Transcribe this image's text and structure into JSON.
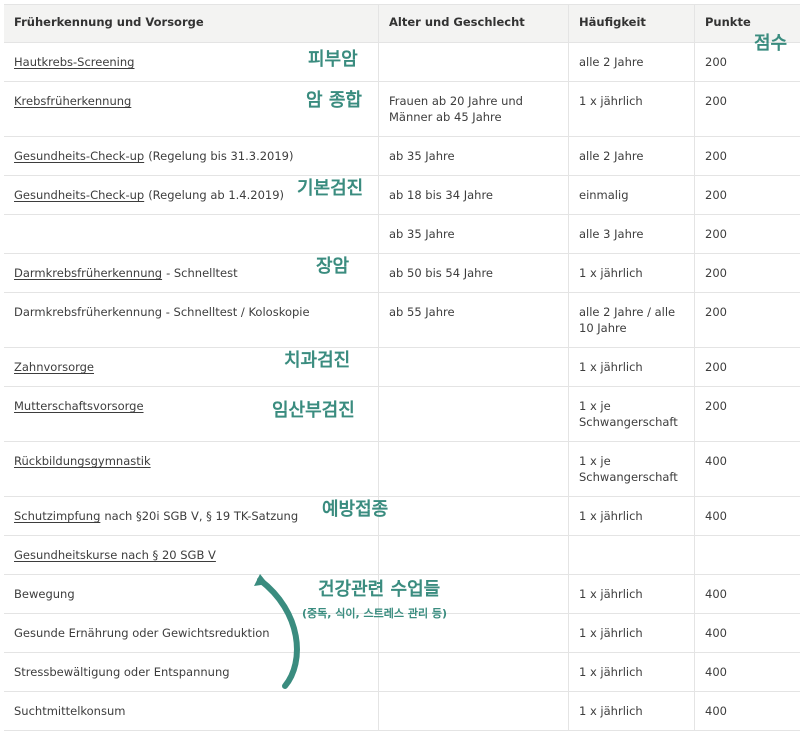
{
  "headers": {
    "col1": "Früherkennung und Vorsorge",
    "col2": "Alter und Geschlecht",
    "col3": "Häufigkeit",
    "col4": "Punkte"
  },
  "points_note": "점수",
  "rows": [
    {
      "c1": "Hautkrebs-Screening",
      "c1_extra": "",
      "c1_link": true,
      "c2": "",
      "c3": "alle 2 Jahre",
      "c4": "200",
      "note": "피부암",
      "h": "r1"
    },
    {
      "c1": "Krebsfrüherkennung",
      "c1_extra": "",
      "c1_link": true,
      "c2": "Frauen ab 20 Jahre und Männer ab 45 Jahre",
      "c3": "1 x jährlich",
      "c4": "200",
      "note": "암 종합",
      "h": "r2"
    },
    {
      "c1": "Gesundheits-Check-up",
      "c1_extra": "(Regelung bis 31.3.2019)",
      "c1_link": true,
      "c2": "ab 35 Jahre",
      "c3": "alle 2 Jahre",
      "c4": "200",
      "note": "",
      "h": "r1"
    },
    {
      "c1": "Gesundheits-Check-up",
      "c1_extra": "(Regelung ab 1.4.2019)",
      "c1_link": true,
      "c2": "ab 18 bis 34 Jahre",
      "c3": "einmalig",
      "c4": "200",
      "note": "기본검진",
      "h": "r1"
    },
    {
      "c1": "",
      "c1_extra": "",
      "c1_link": false,
      "c2": "ab 35 Jahre",
      "c3": "alle 3 Jahre",
      "c4": "200",
      "note": "",
      "h": "r1"
    },
    {
      "c1": "Darmkrebsfrüherkennung",
      "c1_extra": "- Schnelltest",
      "c1_link": true,
      "c2": "ab 50 bis 54 Jahre",
      "c3": "1 x jährlich",
      "c4": "200",
      "note": "장암",
      "h": "r1"
    },
    {
      "c1": "Darmkrebsfrüherkennung - Schnelltest / Koloskopie",
      "c1_extra": "",
      "c1_link": false,
      "c2": "ab 55 Jahre",
      "c3": "alle 2 Jahre / alle 10 Jahre",
      "c4": "200",
      "note": "",
      "h": "r2"
    },
    {
      "c1": "Zahnvorsorge",
      "c1_extra": "",
      "c1_link": true,
      "c2": "",
      "c3": "1 x jährlich",
      "c4": "200",
      "note": "치과검진",
      "h": "r1"
    },
    {
      "c1": "Mutterschaftsvorsorge",
      "c1_extra": "",
      "c1_link": true,
      "c2": "",
      "c3": "1 x je Schwangerschaft",
      "c4": "200",
      "note": "임산부검진",
      "h": "r2"
    },
    {
      "c1": "Rückbildungsgymnastik",
      "c1_extra": "",
      "c1_link": true,
      "c2": "",
      "c3": "1 x je Schwangerschaft",
      "c4": "400",
      "note": "",
      "h": "r2"
    },
    {
      "c1": "Schutzimpfung",
      "c1_extra": "nach §20i SGB V, § 19 TK-Satzung",
      "c1_link": true,
      "c2": "",
      "c3": "1 x jährlich",
      "c4": "400",
      "note": "예방접종",
      "h": "r1"
    },
    {
      "c1": "Gesundheitskurse nach § 20 SGB V",
      "c1_extra": "",
      "c1_link": true,
      "c2": "",
      "c3": "",
      "c4": "",
      "note": "",
      "h": "r1"
    },
    {
      "c1": "Bewegung",
      "c1_extra": "",
      "c1_link": false,
      "c2": "",
      "c3": "1 x jährlich",
      "c4": "400",
      "note": "",
      "h": "r1"
    },
    {
      "c1": "Gesunde Ernährung oder Gewichtsreduktion",
      "c1_extra": "",
      "c1_link": false,
      "c2": "",
      "c3": "1 x jährlich",
      "c4": "400",
      "note": "",
      "h": "r1"
    },
    {
      "c1": "Stressbewältigung oder Entspannung",
      "c1_extra": "",
      "c1_link": false,
      "c2": "",
      "c3": "1 x jährlich",
      "c4": "400",
      "note": "",
      "h": "r1"
    },
    {
      "c1": "Suchtmittelkonsum",
      "c1_extra": "",
      "c1_link": false,
      "c2": "",
      "c3": "1 x jährlich",
      "c4": "400",
      "note": "",
      "h": "r1"
    }
  ],
  "courses_note": "건강관련 수업들",
  "courses_subnote": "(중독, 식이, 스트레스 관리 등)",
  "accent_color": "#3a8c7f"
}
